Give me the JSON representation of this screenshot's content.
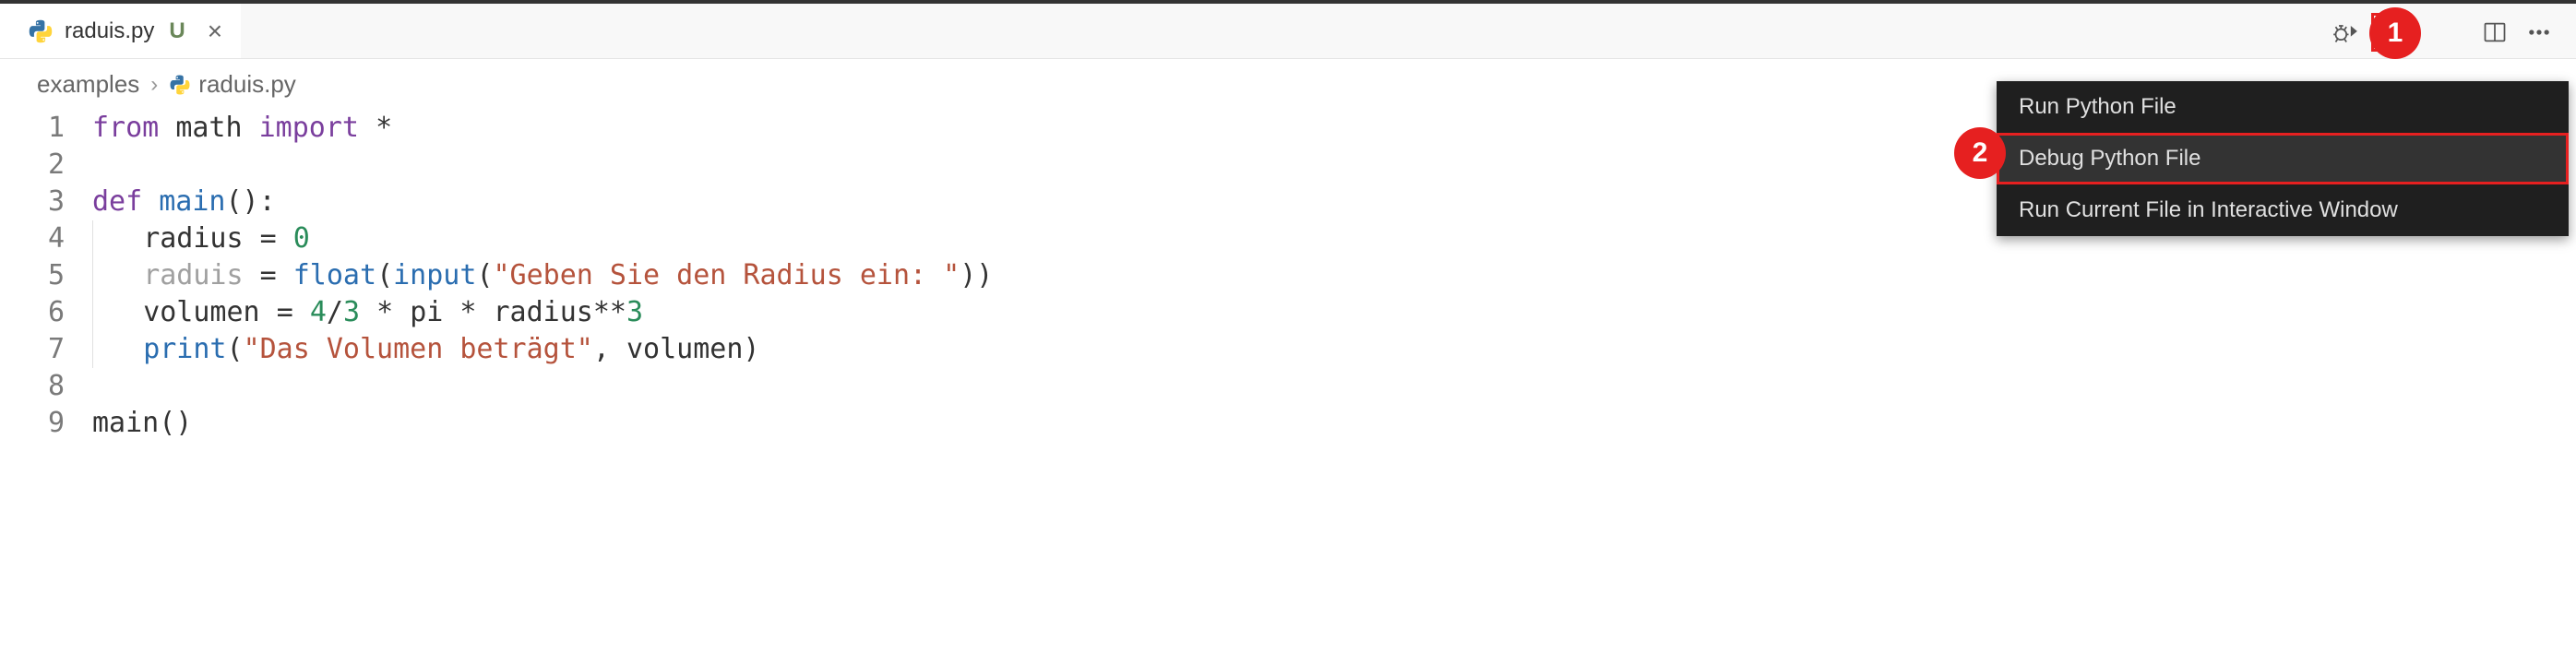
{
  "tab": {
    "filename": "raduis.py",
    "modified_indicator": "U"
  },
  "breadcrumb": {
    "folder": "examples",
    "file": "raduis.py"
  },
  "code": {
    "lines": [
      {
        "n": 1,
        "tokens": [
          [
            "kw",
            "from"
          ],
          [
            "sp",
            " "
          ],
          [
            "const",
            "math"
          ],
          [
            "sp",
            " "
          ],
          [
            "kw",
            "import"
          ],
          [
            "sp",
            " "
          ],
          [
            "op",
            "*"
          ]
        ]
      },
      {
        "n": 2,
        "tokens": []
      },
      {
        "n": 3,
        "tokens": [
          [
            "kw",
            "def"
          ],
          [
            "sp",
            " "
          ],
          [
            "name-def",
            "main"
          ],
          [
            "op",
            "():"
          ]
        ]
      },
      {
        "n": 4,
        "breakpoint": true,
        "indent": 1,
        "tokens": [
          [
            "const",
            "radius"
          ],
          [
            "sp",
            " "
          ],
          [
            "op",
            "="
          ],
          [
            "sp",
            " "
          ],
          [
            "num",
            "0"
          ]
        ]
      },
      {
        "n": 5,
        "indent": 1,
        "tokens": [
          [
            "name-muted",
            "raduis"
          ],
          [
            "sp",
            " "
          ],
          [
            "op",
            "="
          ],
          [
            "sp",
            " "
          ],
          [
            "builtin",
            "float"
          ],
          [
            "op",
            "("
          ],
          [
            "builtin",
            "input"
          ],
          [
            "op",
            "("
          ],
          [
            "str",
            "\"Geben Sie den Radius ein: \""
          ],
          [
            "op",
            "))"
          ]
        ]
      },
      {
        "n": 6,
        "indent": 1,
        "tokens": [
          [
            "const",
            "volumen"
          ],
          [
            "sp",
            " "
          ],
          [
            "op",
            "="
          ],
          [
            "sp",
            " "
          ],
          [
            "num",
            "4"
          ],
          [
            "op",
            "/"
          ],
          [
            "num",
            "3"
          ],
          [
            "sp",
            " "
          ],
          [
            "op",
            "*"
          ],
          [
            "sp",
            " "
          ],
          [
            "const",
            "pi"
          ],
          [
            "sp",
            " "
          ],
          [
            "op",
            "*"
          ],
          [
            "sp",
            " "
          ],
          [
            "const",
            "radius"
          ],
          [
            "op",
            "**"
          ],
          [
            "num",
            "3"
          ]
        ]
      },
      {
        "n": 7,
        "indent": 1,
        "tokens": [
          [
            "builtin",
            "print"
          ],
          [
            "op",
            "("
          ],
          [
            "str",
            "\"Das Volumen beträgt\""
          ],
          [
            "op",
            ","
          ],
          [
            "sp",
            " "
          ],
          [
            "const",
            "volumen"
          ],
          [
            "op",
            ")"
          ]
        ]
      },
      {
        "n": 8,
        "tokens": []
      },
      {
        "n": 9,
        "tokens": [
          [
            "const",
            "main"
          ],
          [
            "op",
            "()"
          ]
        ]
      }
    ]
  },
  "context_menu": {
    "items": [
      {
        "label": "Run Python File",
        "highlighted": false
      },
      {
        "label": "Debug Python File",
        "highlighted": true
      },
      {
        "label": "Run Current File in Interactive Window",
        "highlighted": false
      }
    ]
  },
  "annotations": {
    "one": "1",
    "two": "2"
  }
}
